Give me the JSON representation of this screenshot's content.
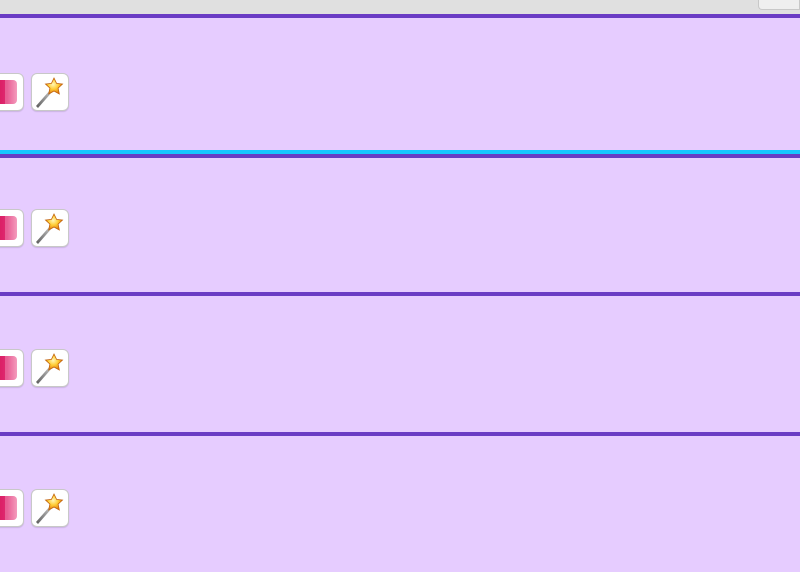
{
  "window": {
    "title": ""
  },
  "rows": [
    {
      "index": 0,
      "tool_icon": "pink-swatch-icon",
      "action_icon": "magic-wand-star-icon"
    },
    {
      "index": 1,
      "tool_icon": "pink-swatch-icon",
      "action_icon": "magic-wand-star-icon"
    },
    {
      "index": 2,
      "tool_icon": "pink-swatch-icon",
      "action_icon": "magic-wand-star-icon"
    },
    {
      "index": 3,
      "tool_icon": "pink-swatch-icon",
      "action_icon": "magic-wand-star-icon"
    }
  ],
  "colors": {
    "row_background": "#e6ccff",
    "row_separator": "#6a3cc4",
    "selection_indicator": "#18c6ff",
    "pink_swatch": "#d4145a",
    "star": "#f3a31b"
  }
}
